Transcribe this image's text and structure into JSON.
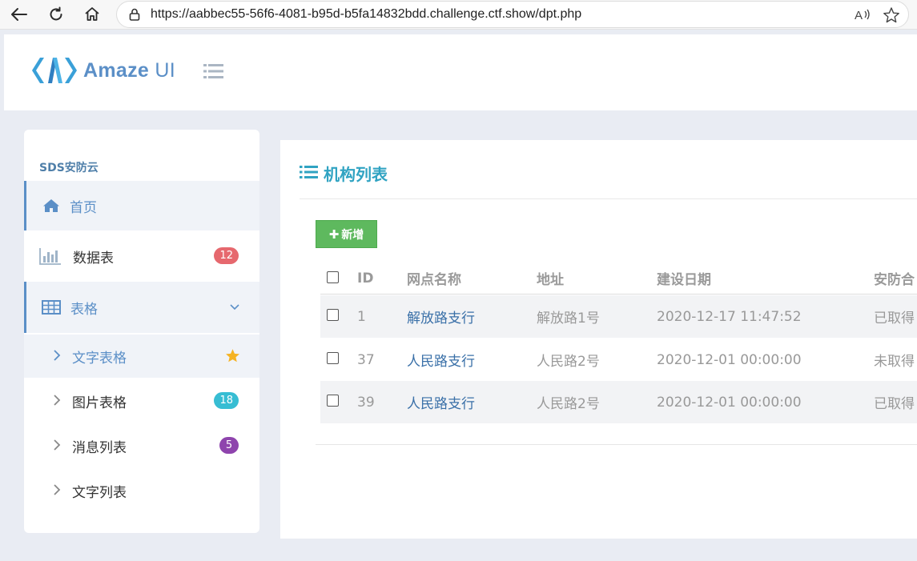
{
  "browser": {
    "url": "https://aabbec55-56f6-4081-b95d-b5fa14832bdd.challenge.ctf.show/dpt.php",
    "icons": [
      "back-icon",
      "refresh-icon",
      "home-icon",
      "lock-icon",
      "read-aloud-icon",
      "favorite-star-icon"
    ]
  },
  "header": {
    "logo_bold": "Amaze",
    "logo_thin": "UI",
    "logo_color": "#5b8fc7"
  },
  "sidebar": {
    "title": "SDS安防云",
    "items": [
      {
        "label": "首页",
        "icon": "home-icon",
        "active": true
      },
      {
        "label": "数据表",
        "icon": "bar-chart-icon",
        "badge": "12",
        "badge_color": "#e6686e"
      },
      {
        "label": "表格",
        "icon": "table-icon",
        "active": true,
        "expanded": true
      }
    ],
    "subitems": [
      {
        "label": "文字表格",
        "icon": "star-icon",
        "active": true
      },
      {
        "label": "图片表格",
        "badge": "18",
        "badge_color": "#37bdd3"
      },
      {
        "label": "消息列表",
        "badge": "5",
        "badge_color": "#8e44ad"
      },
      {
        "label": "文字列表"
      }
    ]
  },
  "main": {
    "title": "机构列表",
    "title_color": "#30a3c2",
    "add_button": "新增",
    "columns": [
      "ID",
      "网点名称",
      "地址",
      "建设日期",
      "安防合"
    ],
    "rows": [
      {
        "id": "1",
        "name": "解放路支行",
        "address": "解放路1号",
        "date": "2020-12-17 11:47:52",
        "security": "已取得"
      },
      {
        "id": "37",
        "name": "人民路支行",
        "address": "人民路2号",
        "date": "2020-12-01 00:00:00",
        "security": "未取得"
      },
      {
        "id": "39",
        "name": "人民路支行",
        "address": "人民路2号",
        "date": "2020-12-01 00:00:00",
        "security": "已取得"
      }
    ]
  }
}
